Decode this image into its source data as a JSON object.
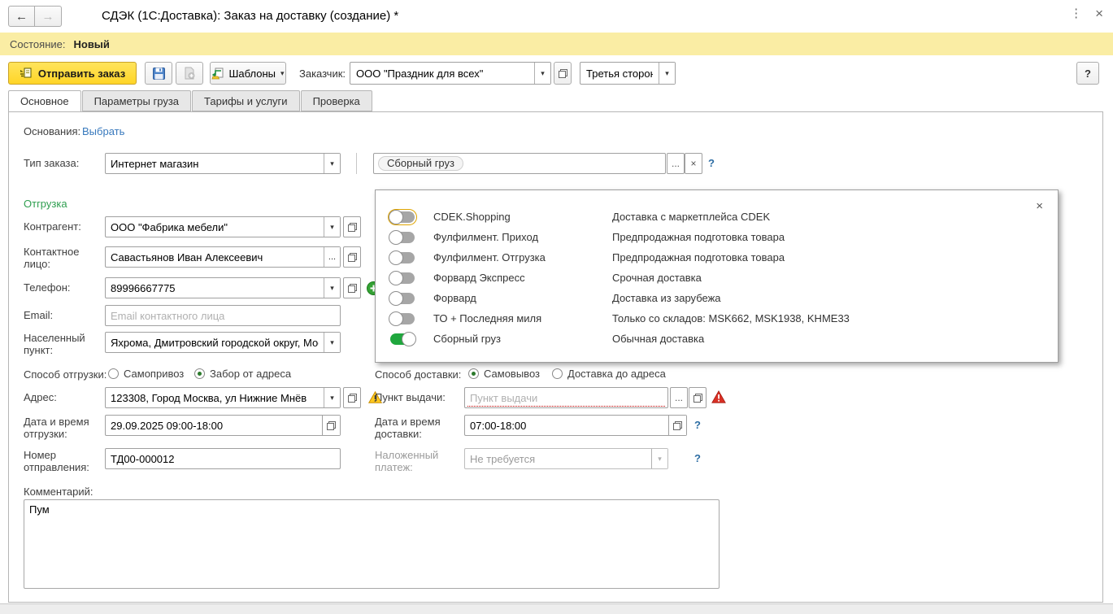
{
  "glyphs": {
    "back": "←",
    "forward": "→",
    "menu": "⋮",
    "close": "×",
    "dropdown": "▾",
    "more": "...",
    "help": "?"
  },
  "colors": {
    "status_bar_bg": "#FAEDA4",
    "accent_yellow_button": "#FFD527",
    "section_green": "#2E9E4F",
    "toggle_on_green": "#1FA73D",
    "link_blue": "#3879BD",
    "warning_yellow": "#FFC91F",
    "error_red": "#D93025"
  },
  "window": {
    "title": "СДЭК (1С:Доставка): Заказ на доставку (создание) *"
  },
  "status_bar": {
    "label": "Состояние:",
    "value": "Новый"
  },
  "toolbar": {
    "send_label": "Отправить заказ",
    "templates_label": "Шаблоны",
    "customer_label": "Заказчик:",
    "customer_value": "ООО \"Праздник для всех\"",
    "payer_value": "Третья сторона"
  },
  "tabs": [
    {
      "label": "Основное",
      "active": true
    },
    {
      "label": "Параметры груза",
      "active": false
    },
    {
      "label": "Тарифы и услуги",
      "active": false
    },
    {
      "label": "Проверка",
      "active": false
    }
  ],
  "form": {
    "basis_label": "Основания:",
    "basis_link": "Выбрать",
    "order_type_label": "Тип заказа:",
    "order_type_value": "Интернет магазин",
    "tariff_tag": "Сборный груз"
  },
  "tariff_popup": {
    "items": [
      {
        "name": "CDEK.Shopping",
        "description": "Доставка с маркетплейса CDEK",
        "enabled": false,
        "focused": true
      },
      {
        "name": "Фулфилмент. Приход",
        "description": "Предпродажная подготовка товара",
        "enabled": false
      },
      {
        "name": "Фулфилмент. Отгрузка",
        "description": "Предпродажная подготовка товара",
        "enabled": false
      },
      {
        "name": "Форвард Экспресс",
        "description": "Срочная доставка",
        "enabled": false
      },
      {
        "name": "Форвард",
        "description": "Доставка из зарубежа",
        "enabled": false
      },
      {
        "name": "ТО + Последняя миля",
        "description": "Только со складов: MSK662, MSK1938, KHME33",
        "enabled": false
      },
      {
        "name": "Сборный груз",
        "description": "Обычная доставка",
        "enabled": true
      }
    ]
  },
  "shipment": {
    "section_title": "Отгрузка",
    "counterparty_label": "Контрагент:",
    "counterparty_value": "ООО \"Фабрика мебели\"",
    "contact_label": "Контактное лицо:",
    "contact_value": "Савастьянов Иван Алексеевич",
    "phone_label": "Телефон:",
    "phone_value": "89996667775",
    "email_label": "Email:",
    "email_placeholder": "Email контактного лица",
    "city_label": "Населенный пункт:",
    "city_value": "Яхрома, Дмитровский городской округ, Мос",
    "method_label": "Способ отгрузки:",
    "method_options": [
      {
        "label": "Самопривоз",
        "selected": false
      },
      {
        "label": "Забор от адреса",
        "selected": true
      }
    ],
    "address_label": "Адрес:",
    "address_value": "123308, Город Москва, ул Нижние Мнёв",
    "datetime_label": "Дата и время отгрузки:",
    "datetime_value": "29.09.2025 09:00-18:00",
    "number_label": "Номер отправления:",
    "number_value": "ТД00-000012",
    "comment_label": "Комментарий:",
    "comment_value": "Пум"
  },
  "delivery": {
    "method_label": "Способ доставки:",
    "method_options": [
      {
        "label": "Самовывоз",
        "selected": true
      },
      {
        "label": "Доставка до адреса",
        "selected": false
      }
    ],
    "pickup_point_label": "Пункт выдачи:",
    "pickup_point_placeholder": "Пункт выдачи",
    "datetime_label": "Дата и время доставки:",
    "datetime_value": "07:00-18:00",
    "cod_label": "Наложенный платеж:",
    "cod_value": "Не требуется"
  }
}
